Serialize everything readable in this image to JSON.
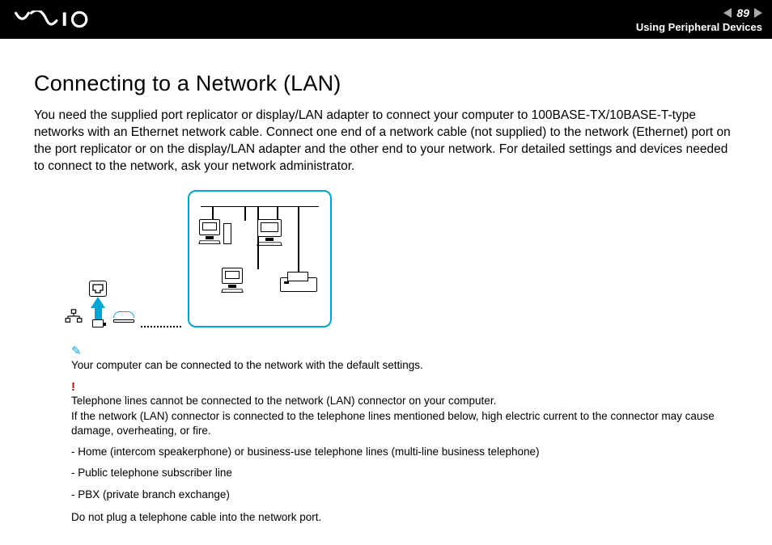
{
  "header": {
    "page_number": "89",
    "section": "Using Peripheral Devices"
  },
  "title": "Connecting to a Network (LAN)",
  "intro": "You need the supplied port replicator or display/LAN adapter to connect your computer to 100BASE-TX/10BASE-T-type networks with an Ethernet network cable. Connect one end of a network cable (not supplied) to the network (Ethernet) port on the port replicator or on the display/LAN adapter and the other end to your network. For detailed settings and devices needed to connect to the network, ask your network administrator.",
  "note": {
    "text": "Your computer can be connected to the network with the default settings."
  },
  "warning": {
    "line1": "Telephone lines cannot be connected to the network (LAN) connector on your computer.",
    "line2": "If the network (LAN) connector is connected to the telephone lines mentioned below, high electric current to the connector may cause damage, overheating, or fire.",
    "bullets": [
      "- Home (intercom speakerphone) or business-use telephone lines (multi-line business telephone)",
      "- Public telephone subscriber line",
      "- PBX (private branch exchange)"
    ],
    "final": "Do not plug a telephone cable into the network port."
  }
}
